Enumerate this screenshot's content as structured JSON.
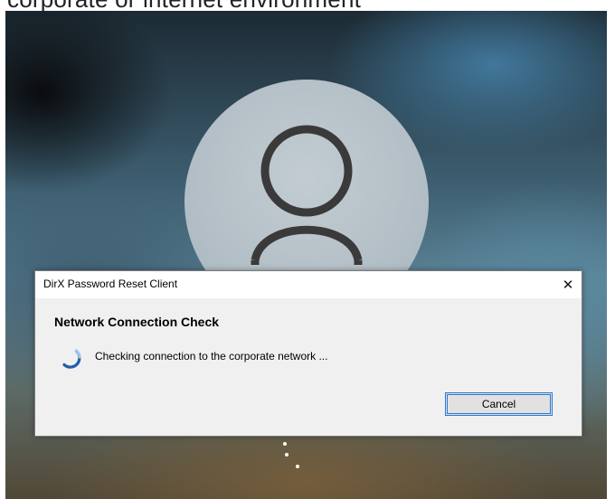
{
  "page": {
    "caption": "corporate or internet environment"
  },
  "dialog": {
    "title": "DirX Password Reset Client",
    "close_glyph": "✕",
    "heading": "Network Connection Check",
    "status": "Checking connection to the corporate network ...",
    "cancel_label": "Cancel"
  },
  "icons": {
    "avatar": "user-silhouette-icon",
    "spinner": "loading-spinner-icon",
    "close": "close-icon",
    "busy": "loading-dots-icon"
  },
  "colors": {
    "accent": "#2b79d4",
    "spinner": "#1f5fa8",
    "dialog_bg": "#f0f0f0"
  }
}
